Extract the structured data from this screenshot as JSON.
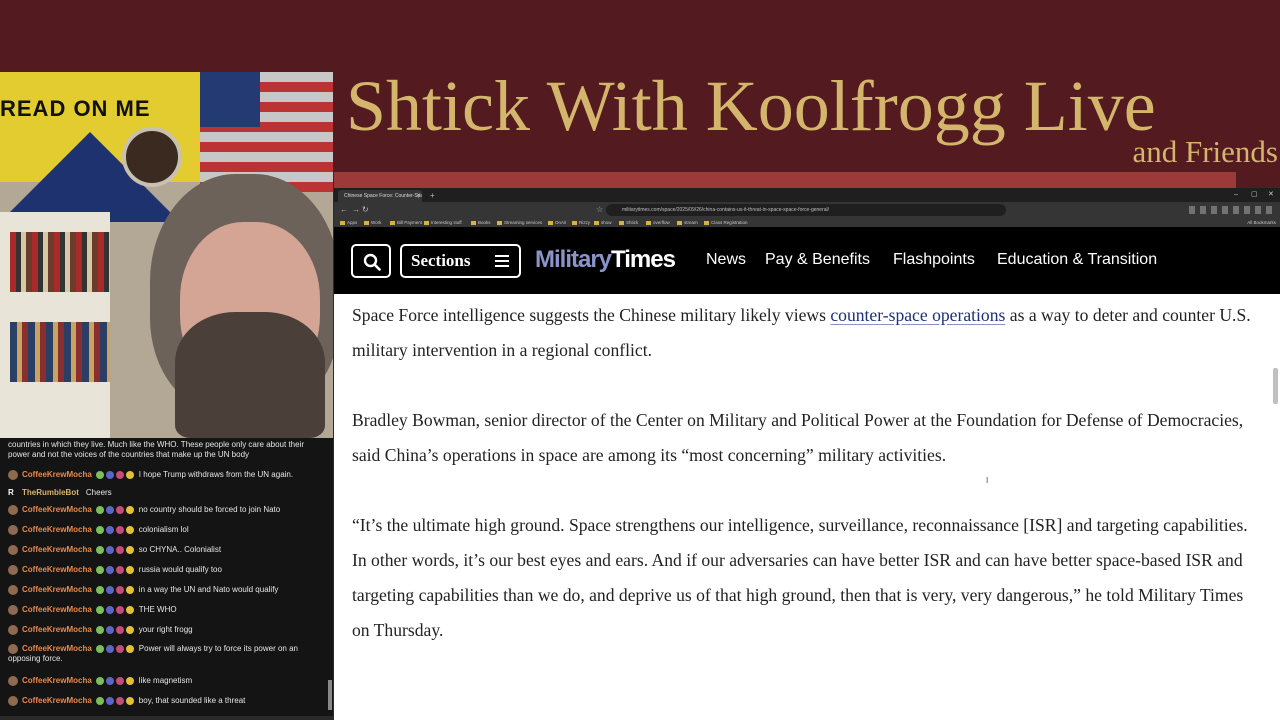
{
  "stream": {
    "title": "Shtick With Koolfrogg Live",
    "subtitle": "and Friends",
    "webcam_flag_text": "READ ON ME"
  },
  "chat": {
    "messages": [
      {
        "user": "",
        "text": "countries in which they live. Much like the WHO. These people only care about their power and not the voices of the countries that make up the UN body"
      },
      {
        "user": "CoffeeKrewMocha",
        "text": "I hope Trump withdraws from the UN again."
      },
      {
        "user": "TheRumbleBot",
        "text": "Cheers",
        "bot": true
      },
      {
        "user": "CoffeeKrewMocha",
        "text": "no country should be forced to join Nato"
      },
      {
        "user": "CoffeeKrewMocha",
        "text": "colonialism lol"
      },
      {
        "user": "CoffeeKrewMocha",
        "text": "so CHYNA.. Colonialist"
      },
      {
        "user": "CoffeeKrewMocha",
        "text": "russia would qualify too"
      },
      {
        "user": "CoffeeKrewMocha",
        "text": "in a way the UN and Nato would qualify"
      },
      {
        "user": "CoffeeKrewMocha",
        "text": "THE WHO"
      },
      {
        "user": "CoffeeKrewMocha",
        "text": "your right frogg"
      },
      {
        "user": "CoffeeKrewMocha",
        "text": "Power will always try to force its power on an opposing force."
      },
      {
        "user": "CoffeeKrewMocha",
        "text": "like magnetism"
      },
      {
        "user": "CoffeeKrewMocha",
        "text": "boy, that sounded like a threat"
      }
    ]
  },
  "browser": {
    "tab_title": "Chinese Space Force: Counter-Space...",
    "url": "militarytimes.com/space/2025/09/26/china-contains-us-it-threat-in-space-space-force-general/",
    "bookmarks": [
      "Apps",
      "Work",
      "Bill Payment",
      "Interesting stuff",
      "Books",
      "Streaming services",
      "OnAir",
      "Rizzy",
      "show",
      "Shtick",
      "overflow",
      "stream",
      "Class Registration"
    ],
    "bookmarks_right": "All Bookmarks"
  },
  "site": {
    "sections_label": "Sections",
    "logo_part1": "Military",
    "logo_part2": "Times",
    "nav": [
      "News",
      "Pay & Benefits",
      "Flashpoints",
      "Education & Transition"
    ]
  },
  "article": {
    "p1_before": "Space Force intelligence suggests the Chinese military likely views ",
    "p1_link": "counter-space operations",
    "p1_after": " as a way to deter and counter U.S. military intervention in a regional conflict.",
    "p2": "Bradley Bowman, senior director of the Center on Military and Political Power at the Foundation for Defense of Democracies, said China’s operations in space are among its “most concerning” military activities.",
    "p3": "“It’s the ultimate high ground. Space strengthens our intelligence, surveillance, reconnaissance [ISR] and targeting capabilities. In other words, it’s our best eyes and ears. And if our adversaries can have better ISR and can have better space-based ISR and targeting capabilities than we do, and deprive us of that high ground, then that is very, very dangerous,” he told Military Times on Thursday."
  }
}
